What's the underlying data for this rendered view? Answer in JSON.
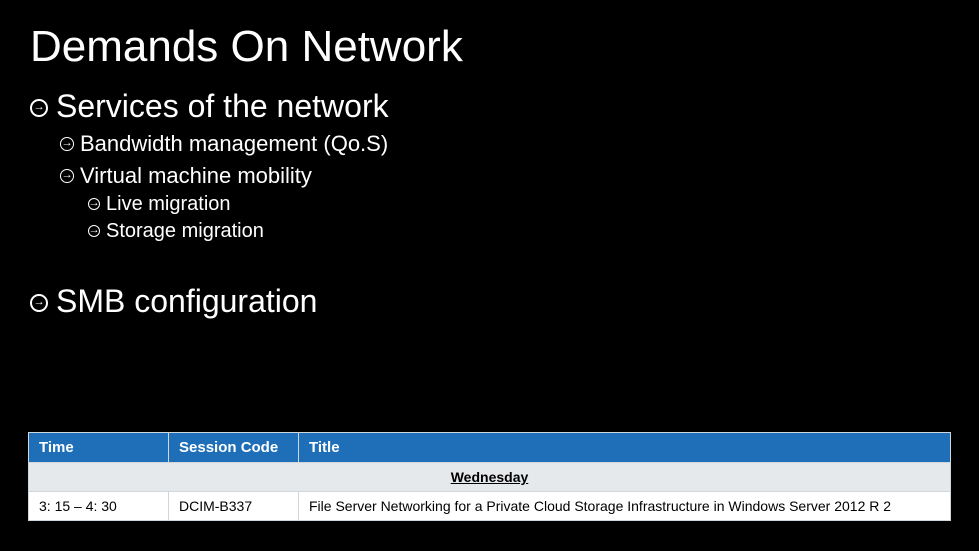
{
  "title": "Demands On Network",
  "bullets": {
    "services": "Services of the network",
    "bandwidth": "Bandwidth management (Qo.S)",
    "vm_mobility": "Virtual machine mobility",
    "live_migration": "Live migration",
    "storage_migration": "Storage migration",
    "smb": "SMB configuration"
  },
  "table": {
    "headers": {
      "time": "Time",
      "code": "Session Code",
      "title": "Title"
    },
    "day": "Wednesday",
    "rows": [
      {
        "time": "3: 15 – 4: 30",
        "code": "DCIM-B337",
        "title": "File Server Networking for a Private Cloud Storage Infrastructure in Windows Server 2012 R 2"
      }
    ]
  }
}
